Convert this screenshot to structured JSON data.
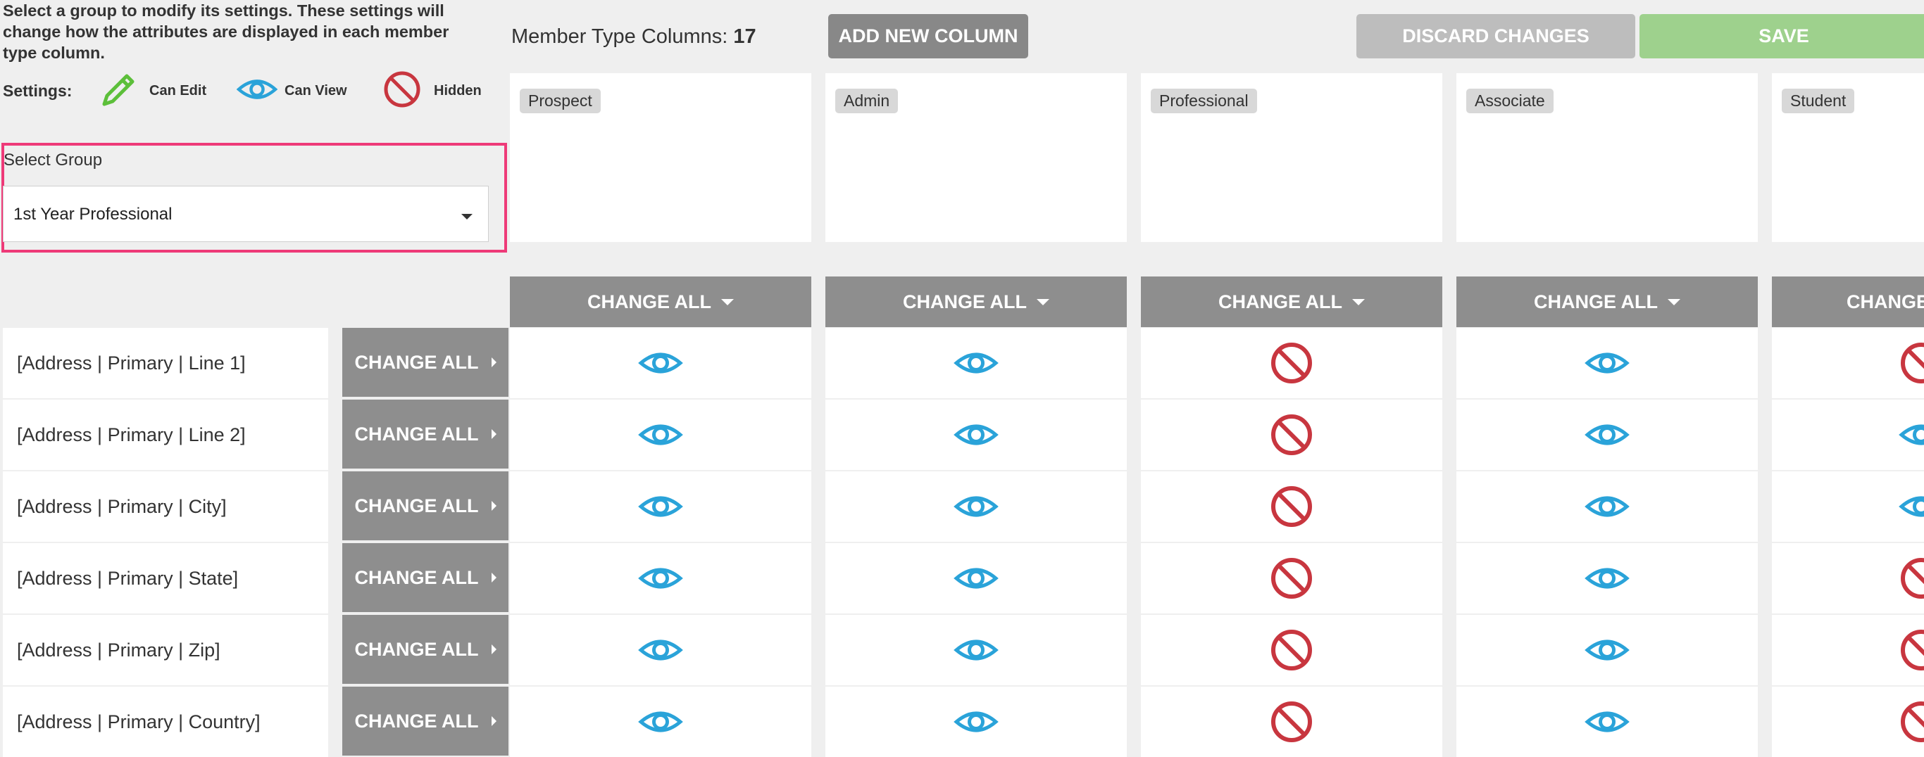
{
  "intro": {
    "line1": "Select a group to modify its settings. These settings will",
    "line2": "change how the attributes are displayed in each member",
    "line3": "type column."
  },
  "settings": {
    "label": "Settings:",
    "can_edit": "Can Edit",
    "can_view": "Can View",
    "hidden": "Hidden"
  },
  "group_select": {
    "label": "Select Group",
    "value": "1st Year Professional"
  },
  "member_type_columns": {
    "label": "Member Type Columns:",
    "count": "17"
  },
  "toolbar": {
    "add_column": "ADD NEW COLUMN",
    "discard": "DISCARD CHANGES",
    "save": "SAVE"
  },
  "columns": [
    {
      "name": "Prospect",
      "header": "CHANGE ALL"
    },
    {
      "name": "Admin",
      "header": "CHANGE ALL"
    },
    {
      "name": "Professional",
      "header": "CHANGE ALL"
    },
    {
      "name": "Associate",
      "header": "CHANGE ALL"
    },
    {
      "name": "Student",
      "header": "CHANGE"
    }
  ],
  "row_button_label": "CHANGE ALL",
  "rows": [
    {
      "label": "[Address | Primary | Line 1]",
      "settings": [
        "view",
        "view",
        "hidden",
        "view",
        "hidden"
      ]
    },
    {
      "label": "[Address | Primary | Line 2]",
      "settings": [
        "view",
        "view",
        "hidden",
        "view",
        "view"
      ]
    },
    {
      "label": "[Address | Primary | City]",
      "settings": [
        "view",
        "view",
        "hidden",
        "view",
        "view"
      ]
    },
    {
      "label": "[Address | Primary | State]",
      "settings": [
        "view",
        "view",
        "hidden",
        "view",
        "hidden"
      ]
    },
    {
      "label": "[Address | Primary | Zip]",
      "settings": [
        "view",
        "view",
        "hidden",
        "view",
        "hidden"
      ]
    },
    {
      "label": "[Address | Primary | Country]",
      "settings": [
        "view",
        "view",
        "hidden",
        "view",
        "hidden"
      ]
    }
  ],
  "colors": {
    "view": "#2aa3d9",
    "hidden": "#c8363f",
    "edit": "#5cbf3a",
    "highlight": "#ee3a78",
    "save": "#9ed18d"
  },
  "icons": {
    "edit": "pencil-icon",
    "view": "eye-icon",
    "hidden": "prohibited-icon"
  }
}
